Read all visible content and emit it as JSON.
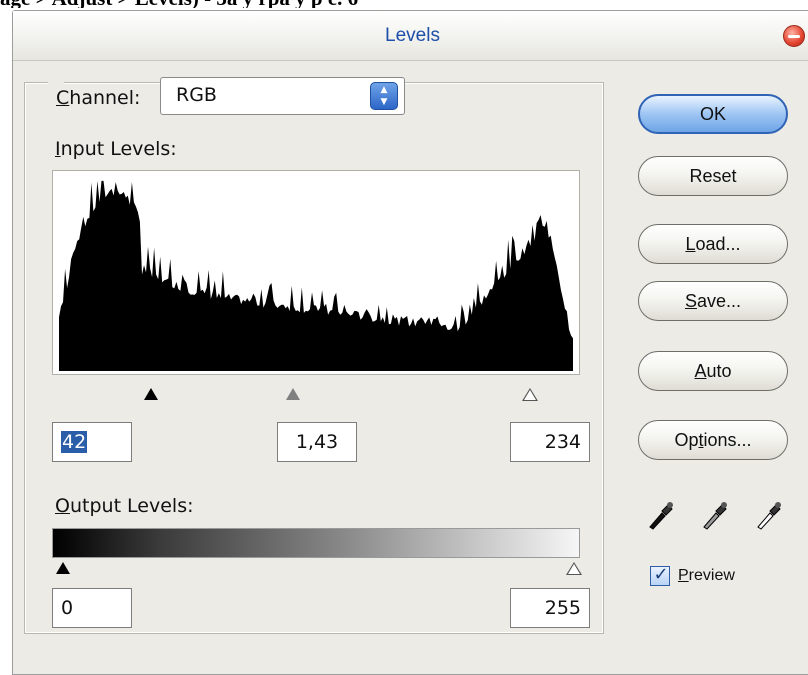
{
  "top_caption": "age > Adjust > Levels) - 3a y rpa y p  e. 6",
  "window": {
    "title": "Levels"
  },
  "channel": {
    "label_u": "C",
    "label_rest": "hannel:",
    "value": "RGB"
  },
  "input_levels": {
    "label_u": "I",
    "label_rest": "nput Levels:",
    "black": "42",
    "gamma": "1,43",
    "white": "234"
  },
  "output_levels": {
    "label_u": "O",
    "label_rest": "utput Levels:",
    "black": "0",
    "white": "255"
  },
  "buttons": {
    "ok": "OK",
    "reset": "Reset",
    "load": {
      "u": "L",
      "rest": "oad..."
    },
    "save": {
      "u": "S",
      "rest": "ave..."
    },
    "auto": {
      "u": "A",
      "rest": "uto"
    },
    "options": {
      "pre": "Op",
      "u": "t",
      "rest": "ions..."
    }
  },
  "preview": {
    "u": "P",
    "rest": "review",
    "checked": true
  },
  "icons": [
    "close-icon",
    "spinner-arrows-icon",
    "black-eyedropper-icon",
    "gray-eyedropper-icon",
    "white-eyedropper-icon",
    "checkmark-icon"
  ]
}
